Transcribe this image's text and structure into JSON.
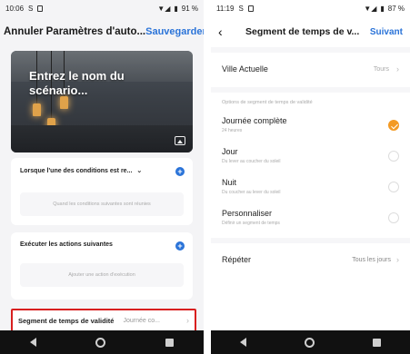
{
  "left": {
    "status": {
      "time": "10:06",
      "battery": "91 %"
    },
    "header": {
      "title": "Annuler Paramètres d'auto...",
      "save": "Sauvegarder"
    },
    "hero": {
      "placeholder": "Entrez le nom du scénario..."
    },
    "conditions": {
      "title": "Lorsque l'une des conditions est re...",
      "hint": "Quand les conditions suivantes sont réunies"
    },
    "actions": {
      "title": "Exécuter les actions suivantes",
      "hint": "Ajouter une action d'exécution"
    },
    "segment": {
      "label": "Segment de temps de validité",
      "value": "Journée co..."
    }
  },
  "right": {
    "status": {
      "time": "11:19",
      "battery": "87 %"
    },
    "header": {
      "title": "Segment de temps de v...",
      "next": "Suivant"
    },
    "city": {
      "label": "Ville Actuelle",
      "value": "Tours"
    },
    "section": "Options de segment de temps de validité",
    "options": [
      {
        "label": "Journée complète",
        "sub": "24 heures",
        "checked": true
      },
      {
        "label": "Jour",
        "sub": "Du lever au coucher du soleil",
        "checked": false
      },
      {
        "label": "Nuit",
        "sub": "Du coucher au lever du soleil",
        "checked": false
      },
      {
        "label": "Personnaliser",
        "sub": "Définir un segment de temps",
        "checked": false
      }
    ],
    "repeat": {
      "label": "Répéter",
      "value": "Tous les jours"
    }
  },
  "colors": {
    "accent": "#2a73d8",
    "check": "#f39a24",
    "highlight": "#d81f1f"
  }
}
